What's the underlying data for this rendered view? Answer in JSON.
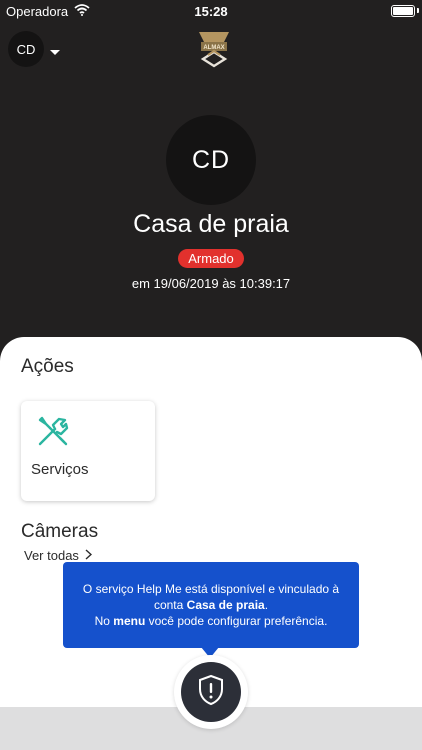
{
  "status_bar": {
    "carrier": "Operadora",
    "time": "15:28",
    "battery_level": 1.0
  },
  "header": {
    "profile_initials": "CD",
    "logo_text": "ALMAX"
  },
  "hero": {
    "initials": "CD",
    "location_name": "Casa de praia",
    "status": "Armado",
    "status_color": "#e2312d",
    "timestamp": "em 19/06/2019 às 10:39:17"
  },
  "actions": {
    "title": "Ações",
    "cards": [
      {
        "label": "Serviços",
        "icon": "tools-icon",
        "icon_color": "#2bb5a0"
      }
    ]
  },
  "cameras": {
    "title": "Câmeras",
    "see_all": "Ver todas"
  },
  "tooltip": {
    "line1": "O serviço Help Me está disponível e vinculado à",
    "line2_prefix": "conta ",
    "line2_bold": "Casa de praia",
    "line2_suffix": ".",
    "line3_prefix": "No ",
    "line3_bold": "menu",
    "line3_suffix": " você pode configurar preferência.",
    "background": "#1551cc"
  },
  "help_button": {
    "icon": "shield-alert-icon"
  }
}
